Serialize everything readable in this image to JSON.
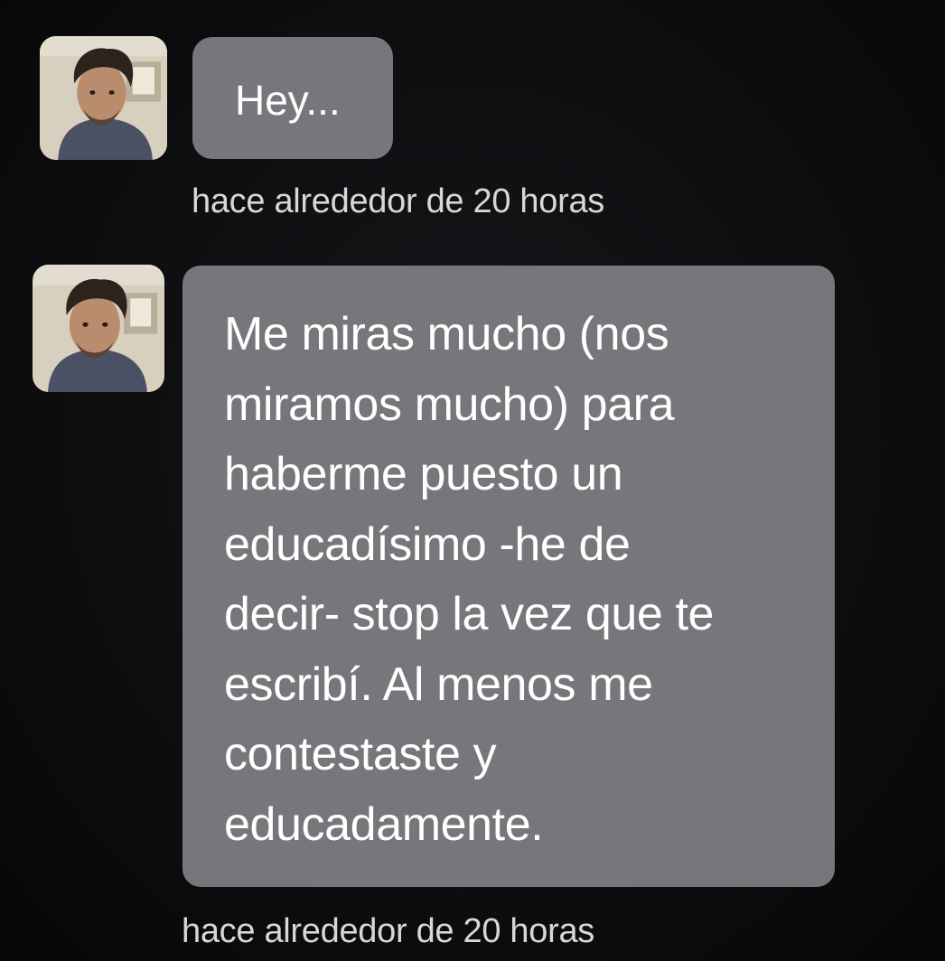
{
  "conversation": {
    "messages": [
      {
        "sender_avatar_icon": "person-avatar-icon",
        "text": "Hey...",
        "timestamp": "hace alrededor de 20 horas"
      },
      {
        "sender_avatar_icon": "person-avatar-icon",
        "text": "Me miras mucho (nos\nmiramos mucho) para\nhaberme puesto un\neducadísimo -he de\ndecir- stop la vez que te\nescribí. Al menos me\ncontestaste y\neducadamente.",
        "timestamp": "hace alrededor de 20 horas"
      }
    ]
  },
  "colors": {
    "background": "#0f0f11",
    "bubble": "#77767a",
    "text": "#ffffff",
    "timestamp": "#d7d7d9"
  }
}
